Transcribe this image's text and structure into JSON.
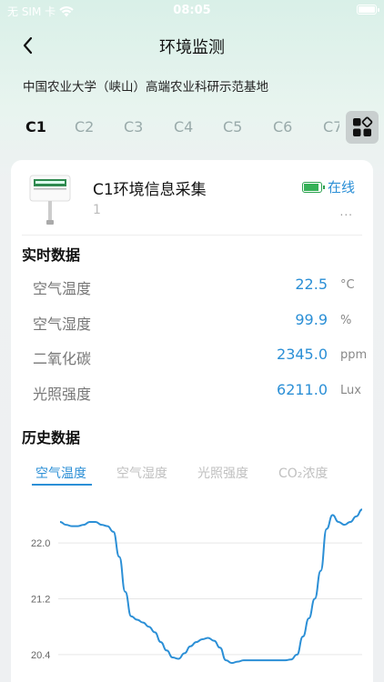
{
  "status_bar": {
    "carrier": "无 SIM 卡",
    "time": "08:05"
  },
  "nav": {
    "title": "环境监测"
  },
  "location": "中国农业大学（峡山）高端农业科研示范基地",
  "tabs": [
    "C1",
    "C2",
    "C3",
    "C4",
    "C5",
    "C6",
    "C7"
  ],
  "device": {
    "image_label": "温度湿度采集器",
    "name": "C1环境信息采集",
    "id": "1",
    "status": "在线",
    "more": "...",
    "battery_level": 0.9
  },
  "realtime": {
    "title": "实时数据",
    "items": [
      {
        "label": "空气温度",
        "value": "22.5",
        "unit": "°C"
      },
      {
        "label": "空气湿度",
        "value": "99.9",
        "unit": "%"
      },
      {
        "label": "二氧化碳",
        "value": "2345.0",
        "unit": "ppm"
      },
      {
        "label": "光照强度",
        "value": "6211.0",
        "unit": "Lux"
      }
    ]
  },
  "history": {
    "title": "历史数据",
    "tabs": [
      "空气温度",
      "空气湿度",
      "光照强度",
      "CO₂浓度"
    ]
  },
  "colors": {
    "accent": "#2b8fd6",
    "online": "#35b157",
    "line": "#2b8fd6"
  },
  "chart_data": {
    "type": "line",
    "ylabel": "",
    "xlabel": "",
    "y_ticks": [
      "22.0",
      "21.2",
      "20.4"
    ],
    "ylim": [
      19.8,
      22.6
    ],
    "series": [
      {
        "values": [
          22.3,
          22.26,
          22.24,
          22.24,
          22.26,
          22.3,
          22.3,
          22.26,
          22.24,
          22.16,
          21.8,
          21.3,
          20.95,
          20.9,
          20.86,
          20.8,
          20.72,
          20.58,
          20.46,
          20.36,
          20.34,
          20.42,
          20.52,
          20.58,
          20.62,
          20.64,
          20.6,
          20.5,
          20.32,
          20.28,
          20.3,
          20.32,
          20.32,
          20.32,
          20.32,
          20.32,
          20.32,
          20.32,
          20.32,
          20.33,
          20.4,
          20.66,
          20.92,
          21.2,
          21.6,
          22.2,
          22.4,
          22.3,
          22.26,
          22.3,
          22.38,
          22.48
        ]
      }
    ]
  }
}
